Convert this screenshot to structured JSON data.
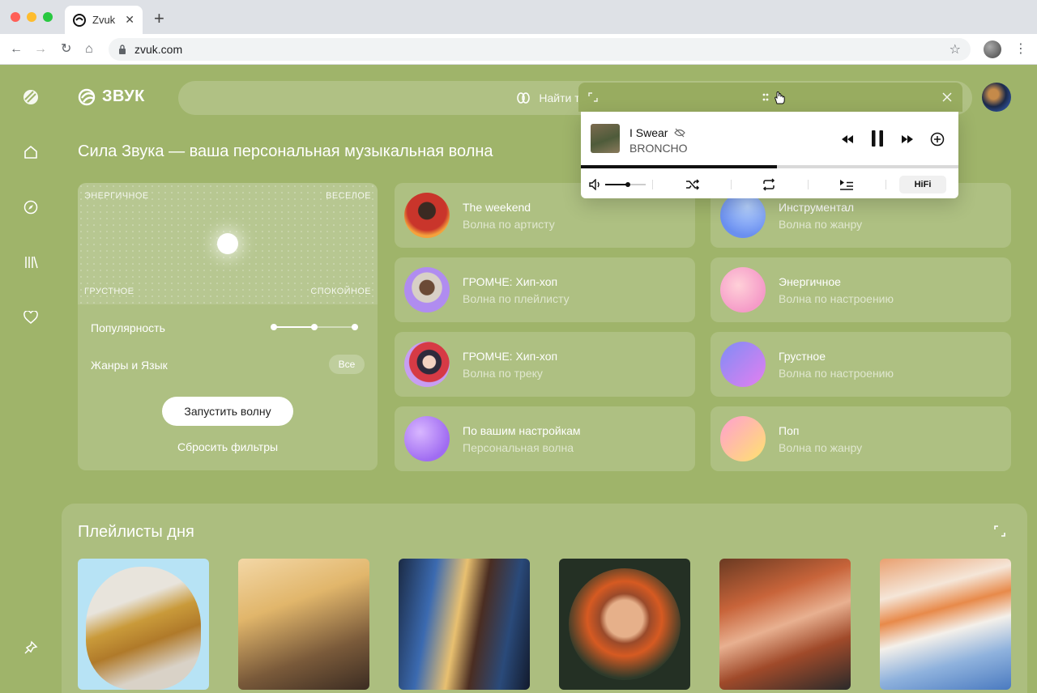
{
  "browser": {
    "tab_title": "Zvuk",
    "new_tab": "+",
    "url": "zvuk.com"
  },
  "header": {
    "logo_text": "ЗВУК",
    "search_placeholder": "Найти трек, подка"
  },
  "hero": {
    "title": "Сила Звука — ваша персональная музыкальная волна"
  },
  "filters": {
    "corners": {
      "top_left": "ЭНЕРГИЧНОЕ",
      "top_right": "ВЕСЕЛОЕ",
      "bottom_left": "ГРУСТНОЕ",
      "bottom_right": "СПОКОЙНОЕ"
    },
    "popularity_label": "Популярность",
    "popularity_level": 0.5,
    "genres_label": "Жанры и Язык",
    "genres_value": "Все",
    "start_button": "Запустить волну",
    "reset_link": "Сбросить фильтры"
  },
  "waves": [
    {
      "title": "The weekend",
      "subtitle": "Волна по артисту"
    },
    {
      "title": "Инструментал",
      "subtitle": "Волна по жанру"
    },
    {
      "title": "ГРОМЧЕ: Хип-хоп",
      "subtitle": "Волна по плейлисту"
    },
    {
      "title": "Энергичное",
      "subtitle": "Волна по настроению"
    },
    {
      "title": "ГРОМЧЕ: Хип-хоп",
      "subtitle": "Волна по треку"
    },
    {
      "title": "Грустное",
      "subtitle": "Волна по настроению"
    },
    {
      "title": "По вашим настройкам",
      "subtitle": "Персональная волна"
    },
    {
      "title": "Поп",
      "subtitle": "Волна по жанру"
    }
  ],
  "playlists": {
    "title": "Плейлисты дня",
    "count_visible": 6
  },
  "mini_player": {
    "track": "I Swear",
    "artist": "BRONCHO",
    "progress": 0.52,
    "volume": 0.55,
    "hifi_label": "HiFi"
  },
  "colors": {
    "background": "#9fb46a",
    "accent": "#111111"
  }
}
